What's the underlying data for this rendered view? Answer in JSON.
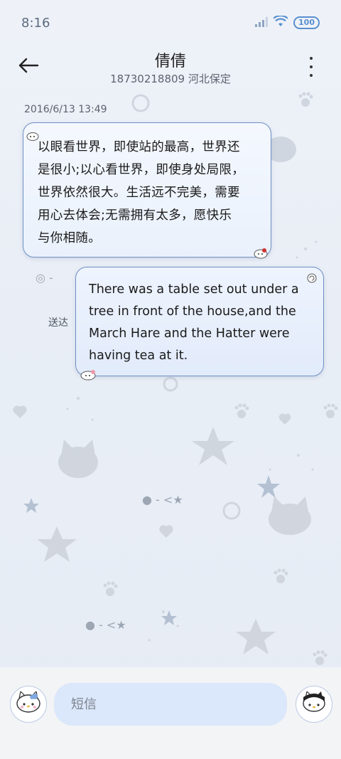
{
  "status_bar": {
    "time": "8:16",
    "battery": "100",
    "icons": [
      "signal-icon",
      "wifi-icon",
      "battery-icon"
    ]
  },
  "header": {
    "contact_name": "倩倩",
    "contact_info": "18730218809 河北保定",
    "back_icon": "back-arrow-icon",
    "more_icon": "more-vertical-icon"
  },
  "conversation": {
    "timestamp": "2016/6/13 13:49",
    "messages": [
      {
        "direction": "incoming",
        "lines": [
          "以眼看世界，即使站的最高，世界还",
          "是很小;以心看世界，即使身处局限，",
          "世界依然很大。生活远不完美，需要",
          "用心去体会;无需拥有太多，愿快乐",
          "与你相随。"
        ]
      },
      {
        "direction": "outgoing",
        "lines": [
          "There was a table set out under a",
          "tree in front of the house,and the",
          "March Hare and the Hatter were",
          "having tea at it."
        ],
        "status": "送达"
      }
    ]
  },
  "composer": {
    "placeholder": "短信",
    "sticker_icon": "hello-kitty-sticker-icon",
    "send_icon": "kitty-send-icon"
  },
  "colors": {
    "bubble_border": "#6f8fc3",
    "input_bg": "#dbe7fa",
    "battery": "#5a8fcf"
  }
}
